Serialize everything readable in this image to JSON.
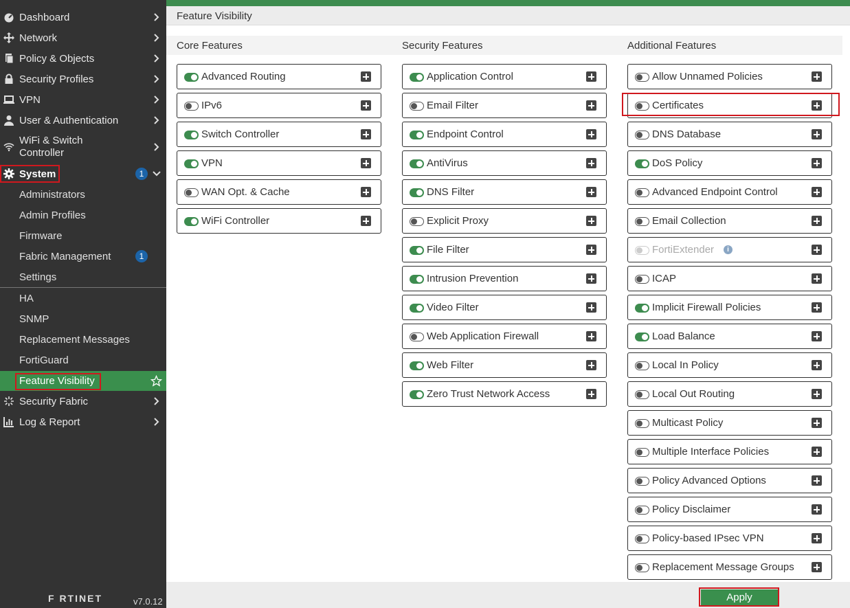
{
  "sidebar": {
    "items": [
      {
        "label": "Dashboard",
        "icon": "dashboard-icon"
      },
      {
        "label": "Network",
        "icon": "network-icon"
      },
      {
        "label": "Policy & Objects",
        "icon": "policy-icon"
      },
      {
        "label": "Security Profiles",
        "icon": "lock-icon"
      },
      {
        "label": "VPN",
        "icon": "monitor-icon"
      },
      {
        "label": "User & Authentication",
        "icon": "user-icon"
      },
      {
        "label": "WiFi & Switch Controller",
        "line1": "WiFi & Switch",
        "line2": "Controller",
        "icon": "wifi-icon"
      },
      {
        "label": "System",
        "icon": "gear-icon",
        "badge": "1"
      }
    ],
    "system_sub": [
      {
        "label": "Administrators"
      },
      {
        "label": "Admin Profiles"
      },
      {
        "label": "Firmware"
      },
      {
        "label": "Fabric Management",
        "badge": "1"
      },
      {
        "label": "Settings"
      },
      {
        "label": "HA"
      },
      {
        "label": "SNMP"
      },
      {
        "label": "Replacement Messages"
      },
      {
        "label": "FortiGuard"
      },
      {
        "label": "Feature Visibility"
      }
    ],
    "bottom_items": [
      {
        "label": "Security Fabric",
        "icon": "fabric-icon"
      },
      {
        "label": "Log & Report",
        "icon": "chart-icon"
      }
    ],
    "brand": "F RTINET",
    "version": "v7.0.12"
  },
  "page": {
    "title": "Feature Visibility",
    "apply_label": "Apply"
  },
  "columns": [
    {
      "heading": "Core Features",
      "features": [
        {
          "name": "Advanced Routing",
          "state": "on"
        },
        {
          "name": "IPv6",
          "state": "off"
        },
        {
          "name": "Switch Controller",
          "state": "on"
        },
        {
          "name": "VPN",
          "state": "on"
        },
        {
          "name": "WAN Opt. & Cache",
          "state": "off"
        },
        {
          "name": "WiFi Controller",
          "state": "on"
        }
      ]
    },
    {
      "heading": "Security Features",
      "features": [
        {
          "name": "Application Control",
          "state": "on"
        },
        {
          "name": "Email Filter",
          "state": "off"
        },
        {
          "name": "Endpoint Control",
          "state": "on"
        },
        {
          "name": "AntiVirus",
          "state": "on"
        },
        {
          "name": "DNS Filter",
          "state": "on"
        },
        {
          "name": "Explicit Proxy",
          "state": "off"
        },
        {
          "name": "File Filter",
          "state": "on"
        },
        {
          "name": "Intrusion Prevention",
          "state": "on"
        },
        {
          "name": "Video Filter",
          "state": "on"
        },
        {
          "name": "Web Application Firewall",
          "state": "off"
        },
        {
          "name": "Web Filter",
          "state": "on"
        },
        {
          "name": "Zero Trust Network Access",
          "state": "on"
        }
      ]
    },
    {
      "heading": "Additional Features",
      "features": [
        {
          "name": "Allow Unnamed Policies",
          "state": "off"
        },
        {
          "name": "Certificates",
          "state": "off"
        },
        {
          "name": "DNS Database",
          "state": "off"
        },
        {
          "name": "DoS Policy",
          "state": "on"
        },
        {
          "name": "Advanced Endpoint Control",
          "state": "off"
        },
        {
          "name": "Email Collection",
          "state": "off"
        },
        {
          "name": "FortiExtender",
          "state": "disabled",
          "info": "i"
        },
        {
          "name": "ICAP",
          "state": "off"
        },
        {
          "name": "Implicit Firewall Policies",
          "state": "on"
        },
        {
          "name": "Load Balance",
          "state": "on"
        },
        {
          "name": "Local In Policy",
          "state": "off"
        },
        {
          "name": "Local Out Routing",
          "state": "off"
        },
        {
          "name": "Multicast Policy",
          "state": "off"
        },
        {
          "name": "Multiple Interface Policies",
          "state": "off"
        },
        {
          "name": "Policy Advanced Options",
          "state": "off"
        },
        {
          "name": "Policy Disclaimer",
          "state": "off"
        },
        {
          "name": "Policy-based IPsec VPN",
          "state": "off"
        },
        {
          "name": "Replacement Message Groups",
          "state": "off"
        }
      ]
    }
  ],
  "colors": {
    "accent": "#3a8f4d",
    "badge": "#1c64a8",
    "highlight": "#d0181e",
    "sidebar": "#333333"
  }
}
